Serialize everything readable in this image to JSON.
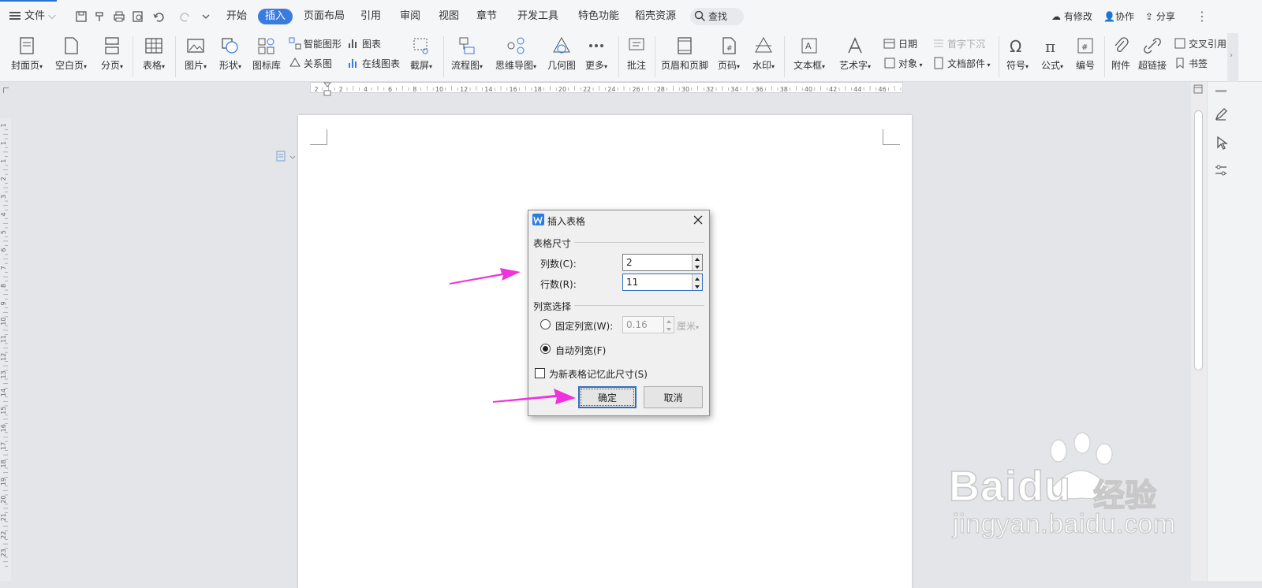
{
  "menubar": {
    "file_label": "文件",
    "tabs": [
      "开始",
      "插入",
      "页面布局",
      "引用",
      "审阅",
      "视图",
      "章节",
      "开发工具",
      "特色功能",
      "稻壳资源"
    ],
    "search_label": "查找",
    "right": {
      "changes": "有修改",
      "collab": "协作",
      "share": "分享"
    }
  },
  "toolbar": {
    "cover": "封面页",
    "blank": "空白页",
    "pagebreak": "分页",
    "table": "表格",
    "picture": "图片",
    "shape": "形状",
    "iconlib": "图标库",
    "smartart": "智能图形",
    "chart": "图表",
    "relation": "关系图",
    "onlinechart": "在线图表",
    "screenshot": "截屏",
    "flowchart": "流程图",
    "mindmap": "思维导图",
    "geometry": "几何图",
    "more": "更多",
    "comment": "批注",
    "header_footer": "页眉和页脚",
    "pagenum": "页码",
    "watermark": "水印",
    "textbox": "文本框",
    "wordart": "艺术字",
    "date": "日期",
    "dropcap": "首字下沉",
    "object": "对象",
    "docpart": "文档部件",
    "symbol": "符号",
    "formula": "公式",
    "numbering": "编号",
    "attachment": "附件",
    "hyperlink": "超链接",
    "crossref": "交叉引用",
    "bookmark": "书签"
  },
  "ruler": {
    "h_ticks": [
      "2",
      "2",
      "4",
      "6",
      "8",
      "10",
      "12",
      "14",
      "16",
      "18",
      "20",
      "22",
      "24",
      "26",
      "28",
      "30",
      "32",
      "34",
      "36",
      "38",
      "40",
      "42",
      "44",
      "46"
    ],
    "v_ticks": [
      "1",
      "1",
      "1",
      "2",
      "3",
      "4",
      "5",
      "6",
      "7",
      "8",
      "9",
      "10",
      "11",
      "12",
      "13",
      "14",
      "15",
      "16",
      "17",
      "18",
      "19",
      "20",
      "21",
      "22",
      "23"
    ]
  },
  "dialog": {
    "title": "插入表格",
    "size_group": "表格尺寸",
    "cols_label": "列数(C):",
    "cols_value": "2",
    "rows_label": "行数(R):",
    "rows_value": "11",
    "width_group": "列宽选择",
    "fixed_label": "固定列宽(W):",
    "fixed_value": "0.16",
    "unit": "厘米",
    "auto_label": "自动列宽(F)",
    "remember_label": "为新表格记忆此尺寸(S)",
    "ok": "确定",
    "cancel": "取消"
  },
  "watermark": {
    "brand": "Baidu",
    "cn": "经验",
    "url": "jingyan.baidu.com"
  },
  "colors": {
    "accent": "#3a7be0",
    "arrow": "#ee33dd",
    "dialog_bg": "#f0f0f0"
  }
}
